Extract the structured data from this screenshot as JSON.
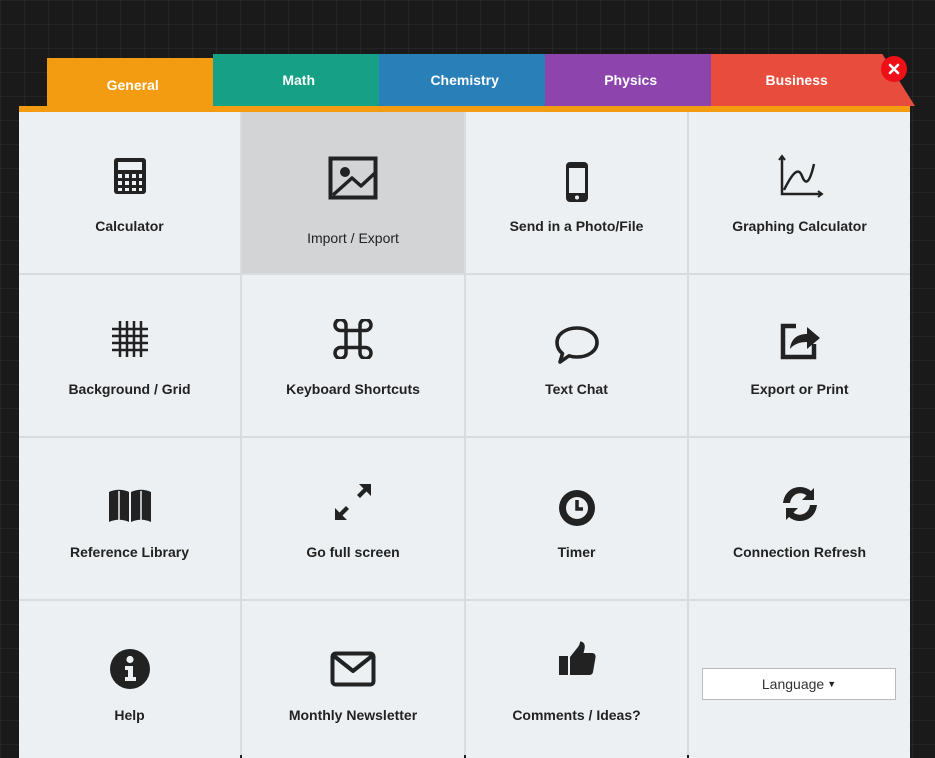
{
  "tabs": [
    {
      "label": "General",
      "color": "#f39c12",
      "active": true
    },
    {
      "label": "Math",
      "color": "#16a085"
    },
    {
      "label": "Chemistry",
      "color": "#2980b9"
    },
    {
      "label": "Physics",
      "color": "#8e44ad"
    },
    {
      "label": "Business",
      "color": "#e74c3c"
    }
  ],
  "accent_color": "#f39c12",
  "close_icon": "close-icon",
  "cells": [
    {
      "label": "Calculator",
      "icon": "calculator-icon"
    },
    {
      "label": "Import / Export",
      "icon": "image-icon",
      "selected": true
    },
    {
      "label": "Send in a Photo/File",
      "icon": "phone-icon"
    },
    {
      "label": "Graphing Calculator",
      "icon": "graph-icon"
    },
    {
      "label": "Background / Grid",
      "icon": "grid-icon"
    },
    {
      "label": "Keyboard Shortcuts",
      "icon": "command-key-icon"
    },
    {
      "label": "Text Chat",
      "icon": "speech-bubble-icon"
    },
    {
      "label": "Export or Print",
      "icon": "share-export-icon"
    },
    {
      "label": "Reference Library",
      "icon": "open-book-icon"
    },
    {
      "label": "Go full screen",
      "icon": "expand-arrows-icon"
    },
    {
      "label": "Timer",
      "icon": "clock-icon"
    },
    {
      "label": "Connection Refresh",
      "icon": "refresh-icon"
    },
    {
      "label": "Help",
      "icon": "info-icon"
    },
    {
      "label": "Monthly Newsletter",
      "icon": "envelope-icon"
    },
    {
      "label": "Comments / Ideas?",
      "icon": "thumbs-up-icon"
    }
  ],
  "language": {
    "label": "Language",
    "caret_icon": "caret-down-icon"
  }
}
